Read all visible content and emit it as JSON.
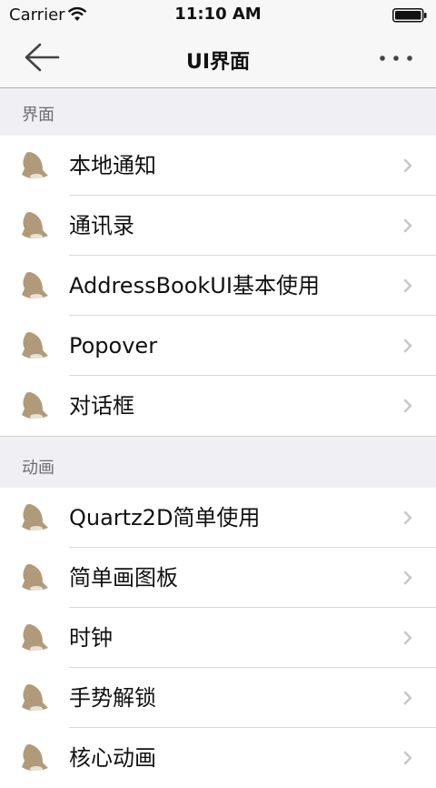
{
  "status_bar": {
    "carrier": "Carrier",
    "time": "11:10 AM"
  },
  "nav": {
    "title": "UI界面"
  },
  "sections": [
    {
      "header": "界面",
      "items": [
        "本地通知",
        "通讯录",
        "AddressBookUI基本使用",
        "Popover",
        "对话框"
      ]
    },
    {
      "header": "动画",
      "items": [
        "Quartz2D简单使用",
        "简单画图板",
        "时钟",
        "手势解锁",
        "核心动画"
      ]
    }
  ],
  "colors": {
    "icon": "#b19a7a",
    "chevron": "#c7c7cc",
    "section_bg": "#efeff4"
  },
  "icons": {
    "row_icon": "bell-icon",
    "back": "back-arrow-icon",
    "more": "more-icon"
  }
}
